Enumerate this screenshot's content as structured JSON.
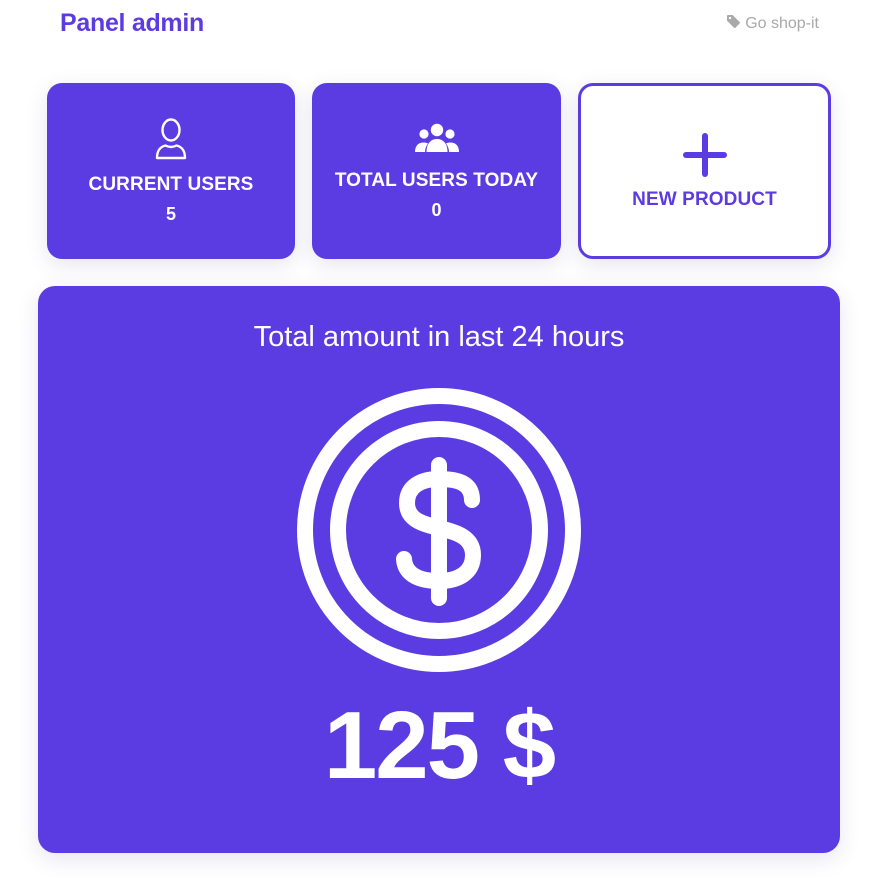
{
  "header": {
    "title": "Panel admin",
    "shop_link": "Go shop-it",
    "shop_icon": "tag-icon"
  },
  "cards": {
    "current_users": {
      "label": "CURRENT USERS",
      "value": "5",
      "icon": "user-icon"
    },
    "total_users_today": {
      "label": "TOTAL USERS TODAY",
      "value": "0",
      "icon": "users-group-icon"
    },
    "new_product": {
      "label": "NEW PRODUCT",
      "icon": "plus-icon"
    }
  },
  "amount_card": {
    "title": "Total amount in last 24 hours",
    "amount": "125 $",
    "icon": "dollar-coin-icon"
  },
  "colors": {
    "accent": "#5b3ce2",
    "link": "#a9a9a9",
    "background": "#ffffff"
  }
}
